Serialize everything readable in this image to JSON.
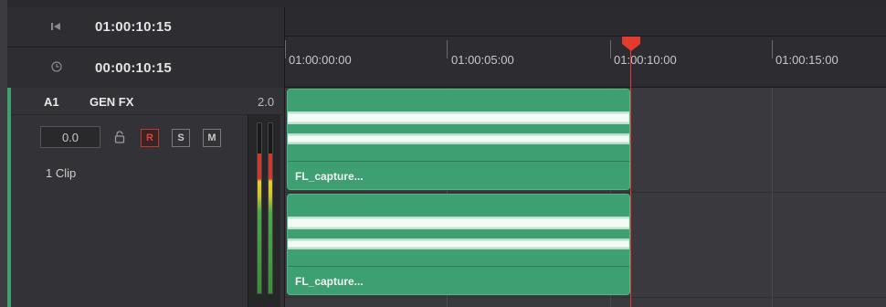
{
  "header": {
    "row1": {
      "icon": "skip-to-start-icon",
      "timecode": "01:00:10:15"
    },
    "row2": {
      "icon": "clock-icon",
      "timecode": "00:00:10:15"
    }
  },
  "ruler": {
    "labels": [
      "01:00:00:00",
      "01:00:05:00",
      "01:00:10:00",
      "01:00:15:00"
    ]
  },
  "track": {
    "id": "A1",
    "name": "GEN FX",
    "channels": "2.0",
    "volume": "0.0",
    "buttons": {
      "record": "R",
      "solo": "S",
      "mute": "M"
    },
    "clip_count": "1 Clip",
    "record_armed": true
  },
  "clips": [
    {
      "name": "FL_capture..."
    },
    {
      "name": "FL_capture..."
    }
  ],
  "colors": {
    "clip_green": "#3e9f72",
    "playhead_red": "#e53a2f",
    "record_red": "#c0392b"
  }
}
